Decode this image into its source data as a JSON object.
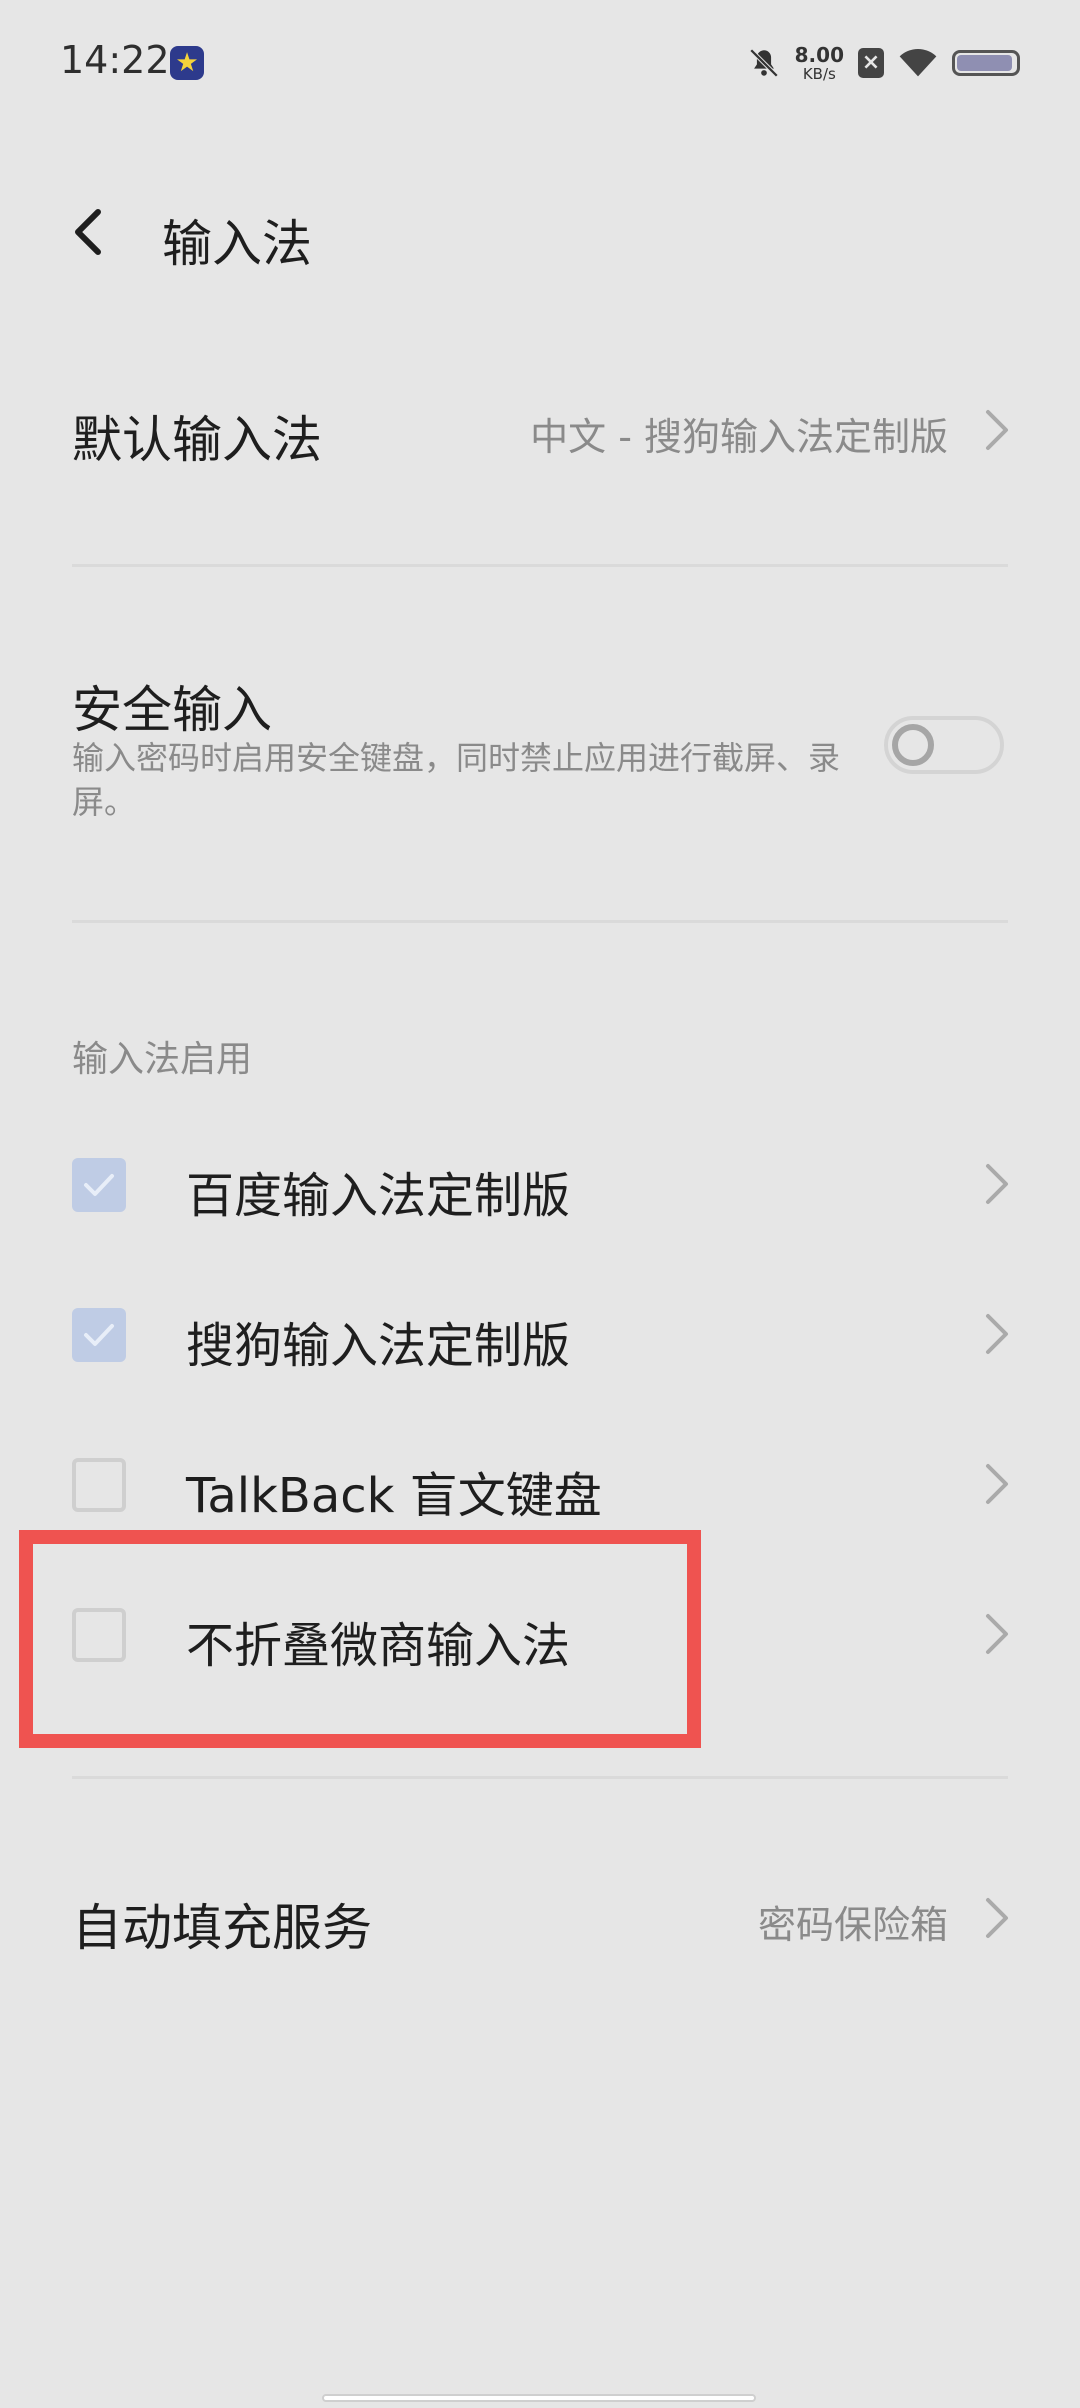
{
  "status_bar": {
    "time": "14:22",
    "net_speed_value": "8.00",
    "net_speed_unit": "KB/s",
    "battery_level": 0.95
  },
  "header": {
    "title": "输入法"
  },
  "default_ime": {
    "label": "默认输入法",
    "value": "中文 - 搜狗输入法定制版"
  },
  "secure_input": {
    "label": "安全输入",
    "description": "输入密码时启用安全键盘，同时禁止应用进行截屏、录屏。",
    "enabled": false
  },
  "ime_section": {
    "header": "输入法启用",
    "items": [
      {
        "label": "百度输入法定制版",
        "checked": true
      },
      {
        "label": "搜狗输入法定制版",
        "checked": true
      },
      {
        "label": "TalkBack 盲文键盘",
        "checked": false
      },
      {
        "label": "不折叠微商输入法",
        "checked": false
      }
    ]
  },
  "autofill": {
    "label": "自动填充服务",
    "value": "密码保险箱"
  },
  "colors": {
    "background": "#e6e6e6",
    "highlight": "#ef5350",
    "checkbox_checked": "#bfcce5"
  }
}
